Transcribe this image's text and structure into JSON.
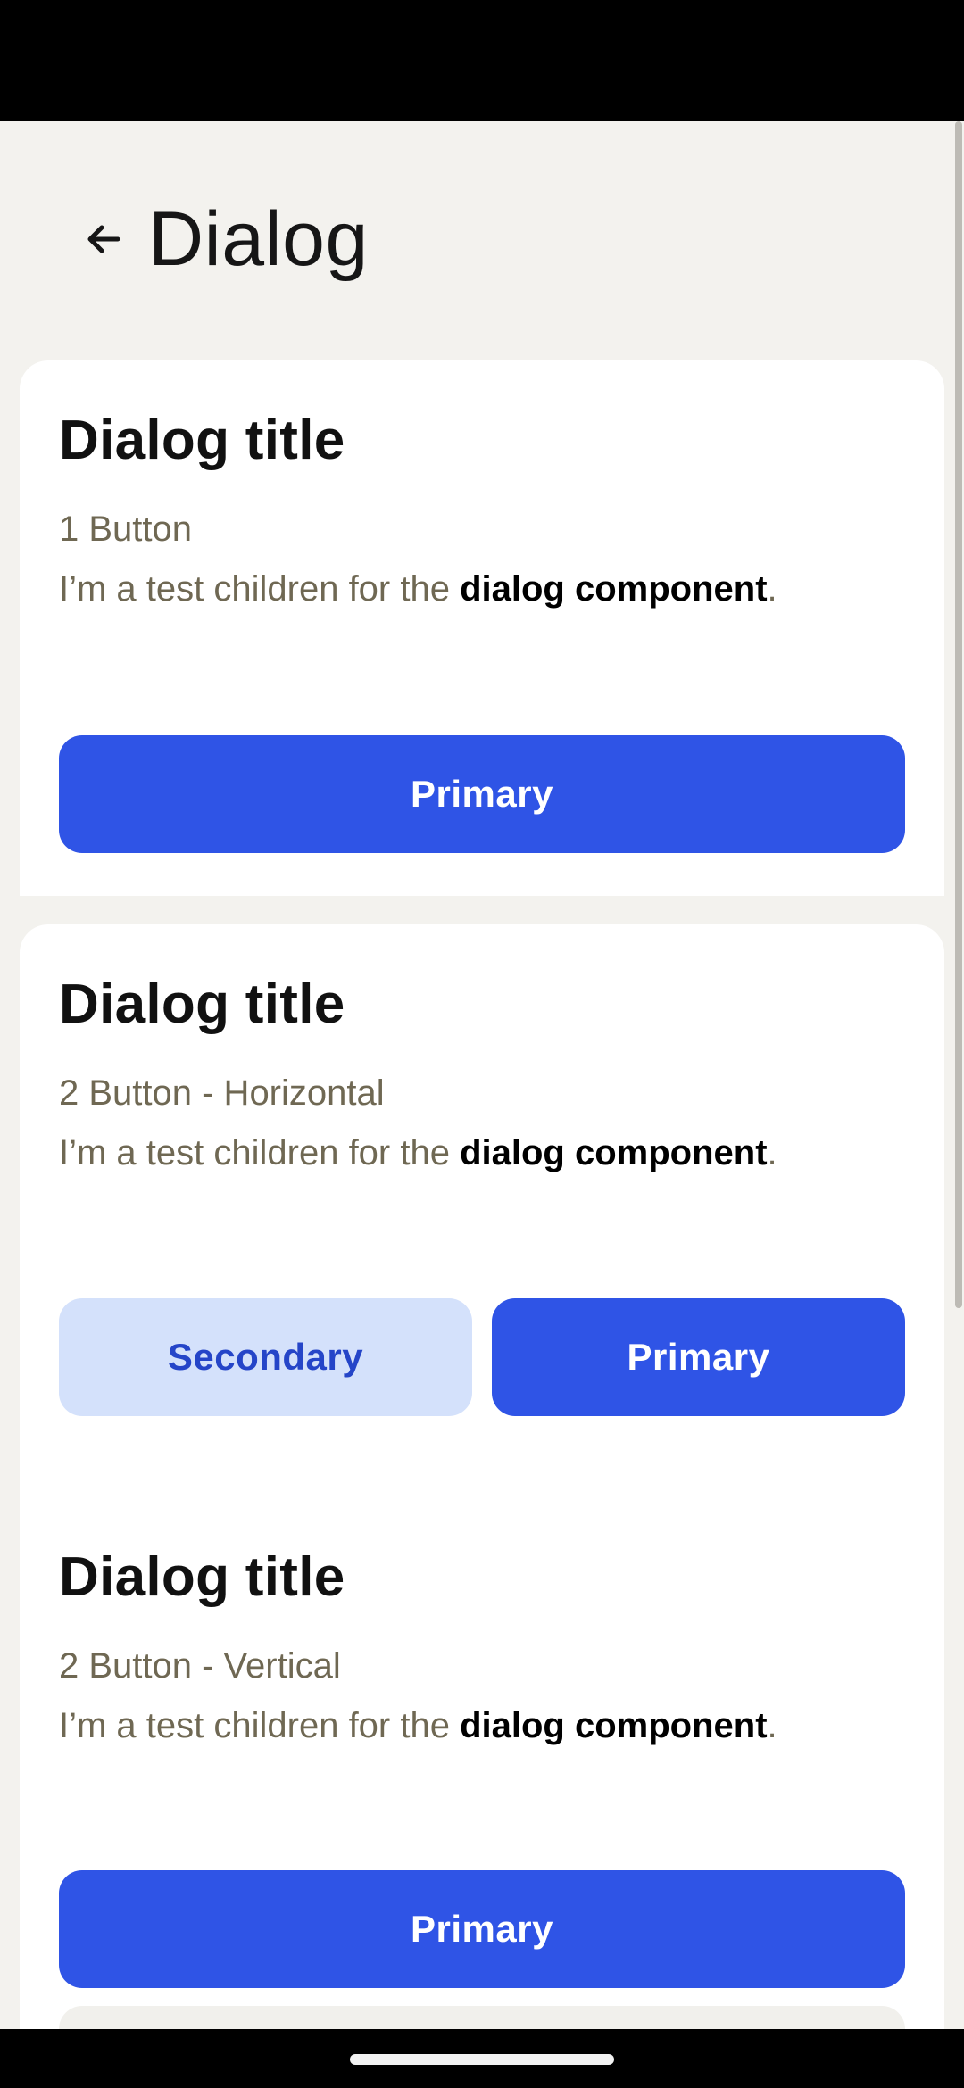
{
  "header": {
    "title": "Dialog",
    "back_icon": "arrow-left-icon"
  },
  "cards": [
    {
      "title": "Dialog title",
      "subtitle": "1 Button",
      "body_prefix": "I’m a test children for the ",
      "body_bold": "dialog component",
      "body_suffix": ".",
      "buttons": {
        "primary": "Primary"
      }
    },
    {
      "title": "Dialog title",
      "subtitle": "2 Button - Horizontal",
      "body_prefix": "I’m a test children for the ",
      "body_bold": "dialog component",
      "body_suffix": ".",
      "buttons": {
        "secondary": "Secondary",
        "primary": "Primary"
      }
    },
    {
      "title": "Dialog title",
      "subtitle": "2 Button - Vertical",
      "body_prefix": "I’m a test children for the ",
      "body_bold": "dialog component",
      "body_suffix": ".",
      "buttons": {
        "primary": "Primary"
      }
    }
  ],
  "colors": {
    "background": "#F3F2EE",
    "primary": "#2F54E6",
    "secondary_bg": "#D4E1FB",
    "secondary_text": "#2545C8",
    "muted_text": "#6F6853"
  }
}
